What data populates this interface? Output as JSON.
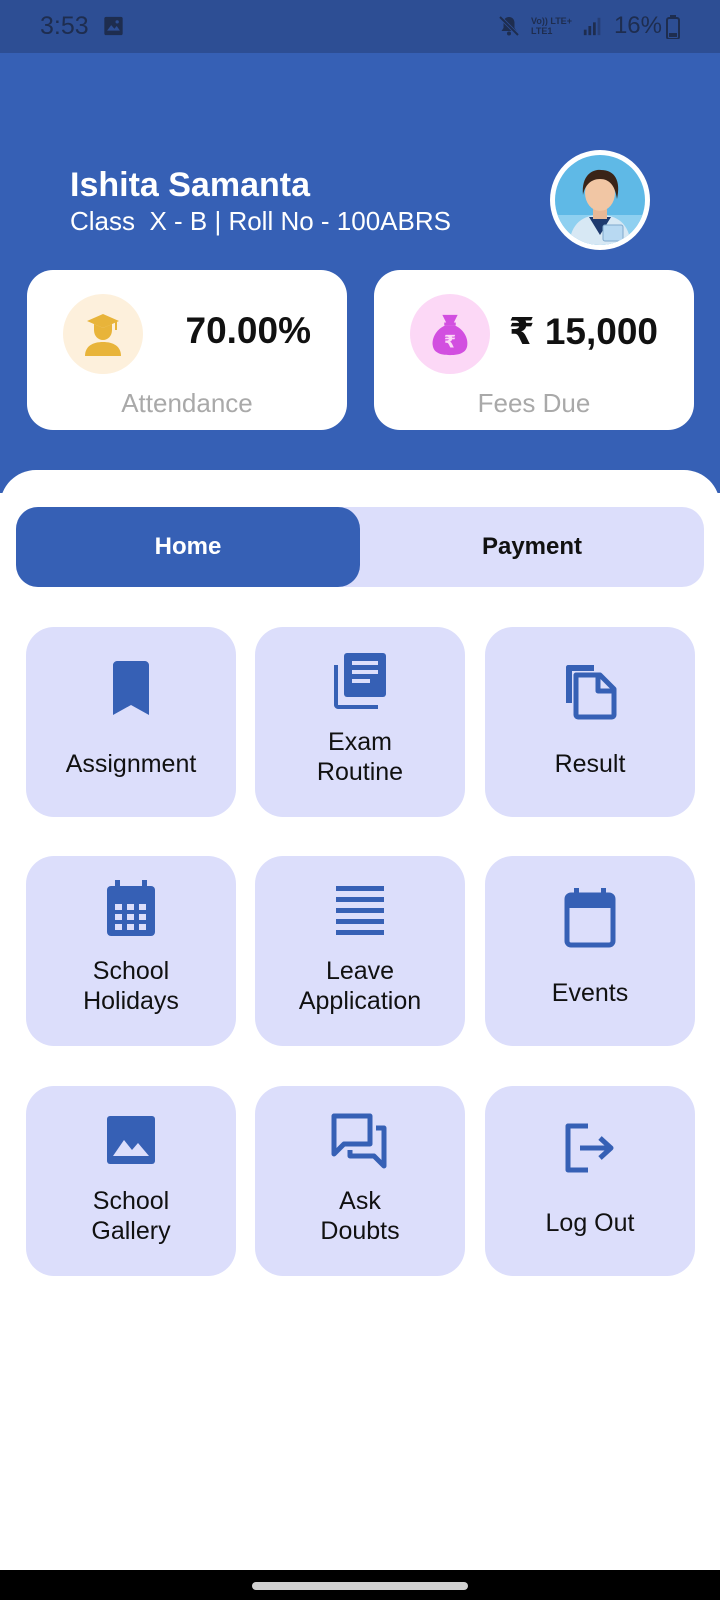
{
  "status_bar": {
    "time": "3:53",
    "network_top": "Vo)) LTE+",
    "network_bottom": "LTE1",
    "battery": "16%",
    "icons": [
      "image-icon",
      "mute-icon",
      "signal-icon",
      "battery-icon"
    ]
  },
  "profile": {
    "name": "Ishita Samanta",
    "class_info": "Class  X - B | Roll No - 100ABRS"
  },
  "stats": {
    "attendance": {
      "value": "70.00%",
      "label": "Attendance",
      "icon": "student-icon"
    },
    "fees": {
      "value": "₹ 15,000",
      "label": "Fees Due",
      "icon": "money-bag-icon"
    }
  },
  "tabs": [
    {
      "label": "Home",
      "active": true
    },
    {
      "label": "Payment",
      "active": false
    }
  ],
  "menu": [
    {
      "label": "Assignment",
      "icon": "bookmark-icon"
    },
    {
      "label": "Exam\nRoutine",
      "icon": "library-books-icon"
    },
    {
      "label": "Result",
      "icon": "copy-icon"
    },
    {
      "label": "School\nHolidays",
      "icon": "calendar-grid-icon"
    },
    {
      "label": "Leave\nApplication",
      "icon": "lines-icon"
    },
    {
      "label": "Events",
      "icon": "calendar-icon"
    },
    {
      "label": "School\nGallery",
      "icon": "image-icon"
    },
    {
      "label": "Ask\nDoubts",
      "icon": "chat-icon"
    },
    {
      "label": "Log Out",
      "icon": "logout-icon"
    }
  ],
  "colors": {
    "primary": "#3660b5",
    "tile_bg": "#dcdefb",
    "attendance_icon_bg": "#fdf0dc",
    "fees_icon_bg": "#fcd8f6",
    "attendance_icon": "#e8b43a",
    "fees_icon": "#d24fe0"
  }
}
